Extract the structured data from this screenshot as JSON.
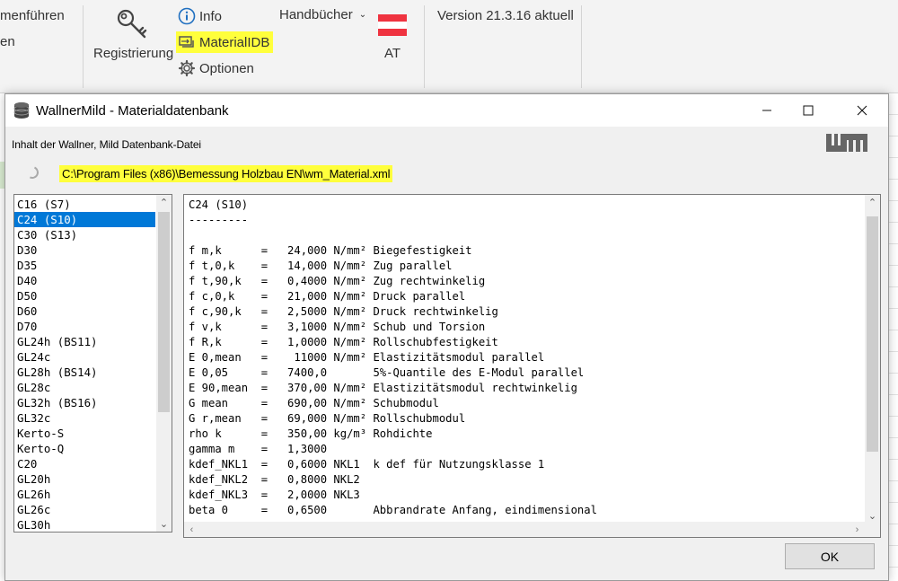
{
  "ribbon": {
    "left_cut_1": "menführen",
    "left_cut_2": "en",
    "registrierung": "Registrierung",
    "info": "Info",
    "materialdb": "MaterialIDB",
    "optionen": "Optionen",
    "handbuecher": "Handbücher",
    "language": "AT",
    "version": "Version 21.3.16 aktuell",
    "colors": {
      "highlight": "#ffff3c",
      "flag_red": "#ef3340",
      "info_blue": "#1f6fc0"
    }
  },
  "window": {
    "title": "WallnerMild - Materialdatenbank",
    "content_label": "Inhalt der Wallner, Mild  Datenbank-Datei",
    "file_path": "C:\\Program Files (x86)\\Bemessung Holzbau EN\\wm_Material.xml",
    "ok_label": "OK",
    "icons": [
      "database-icon",
      "minimize-icon",
      "maximize-icon",
      "close-icon",
      "wm-logo",
      "spinner-icon"
    ]
  },
  "materials": [
    "C16 (S7)",
    "C24 (S10)",
    "C30 (S13)",
    "D30",
    "D35",
    "D40",
    "D50",
    "D60",
    "D70",
    "GL24h (BS11)",
    "GL24c",
    "GL28h (BS14)",
    "GL28c",
    "GL32h (BS16)",
    "GL32c",
    "Kerto-S",
    "Kerto-Q",
    "C20",
    "GL20h",
    "GL26h",
    "GL26c",
    "GL30h"
  ],
  "selected_material": "C24 (S10)",
  "detail_lines": [
    "C24 (S10)",
    "---------",
    "",
    "f m,k      =   24,000 N/mm² Biegefestigkeit",
    "f t,0,k    =   14,000 N/mm² Zug parallel",
    "f t,90,k   =   0,4000 N/mm² Zug rechtwinkelig",
    "f c,0,k    =   21,000 N/mm² Druck parallel",
    "f c,90,k   =   2,5000 N/mm² Druck rechtwinkelig",
    "f v,k      =   3,1000 N/mm² Schub und Torsion",
    "f R,k      =   1,0000 N/mm² Rollschubfestigkeit",
    "E 0,mean   =    11000 N/mm² Elastizitätsmodul parallel",
    "E 0,05     =   7400,0       5%-Quantile des E-Modul parallel",
    "E 90,mean  =   370,00 N/mm² Elastizitätsmodul rechtwinkelig",
    "G mean     =   690,00 N/mm² Schubmodul",
    "G r,mean   =   69,000 N/mm² Rollschubmodul",
    "rho k      =   350,00 kg/m³ Rohdichte",
    "gamma m    =   1,3000",
    "kdef_NKL1  =   0,6000 NKL1  k def für Nutzungsklasse 1",
    "kdef_NKL2  =   0,8000 NKL2",
    "kdef_NKL3  =   2,0000 NKL3",
    "beta 0     =   0,6500       Abbrandrate Anfang, eindimensional"
  ]
}
